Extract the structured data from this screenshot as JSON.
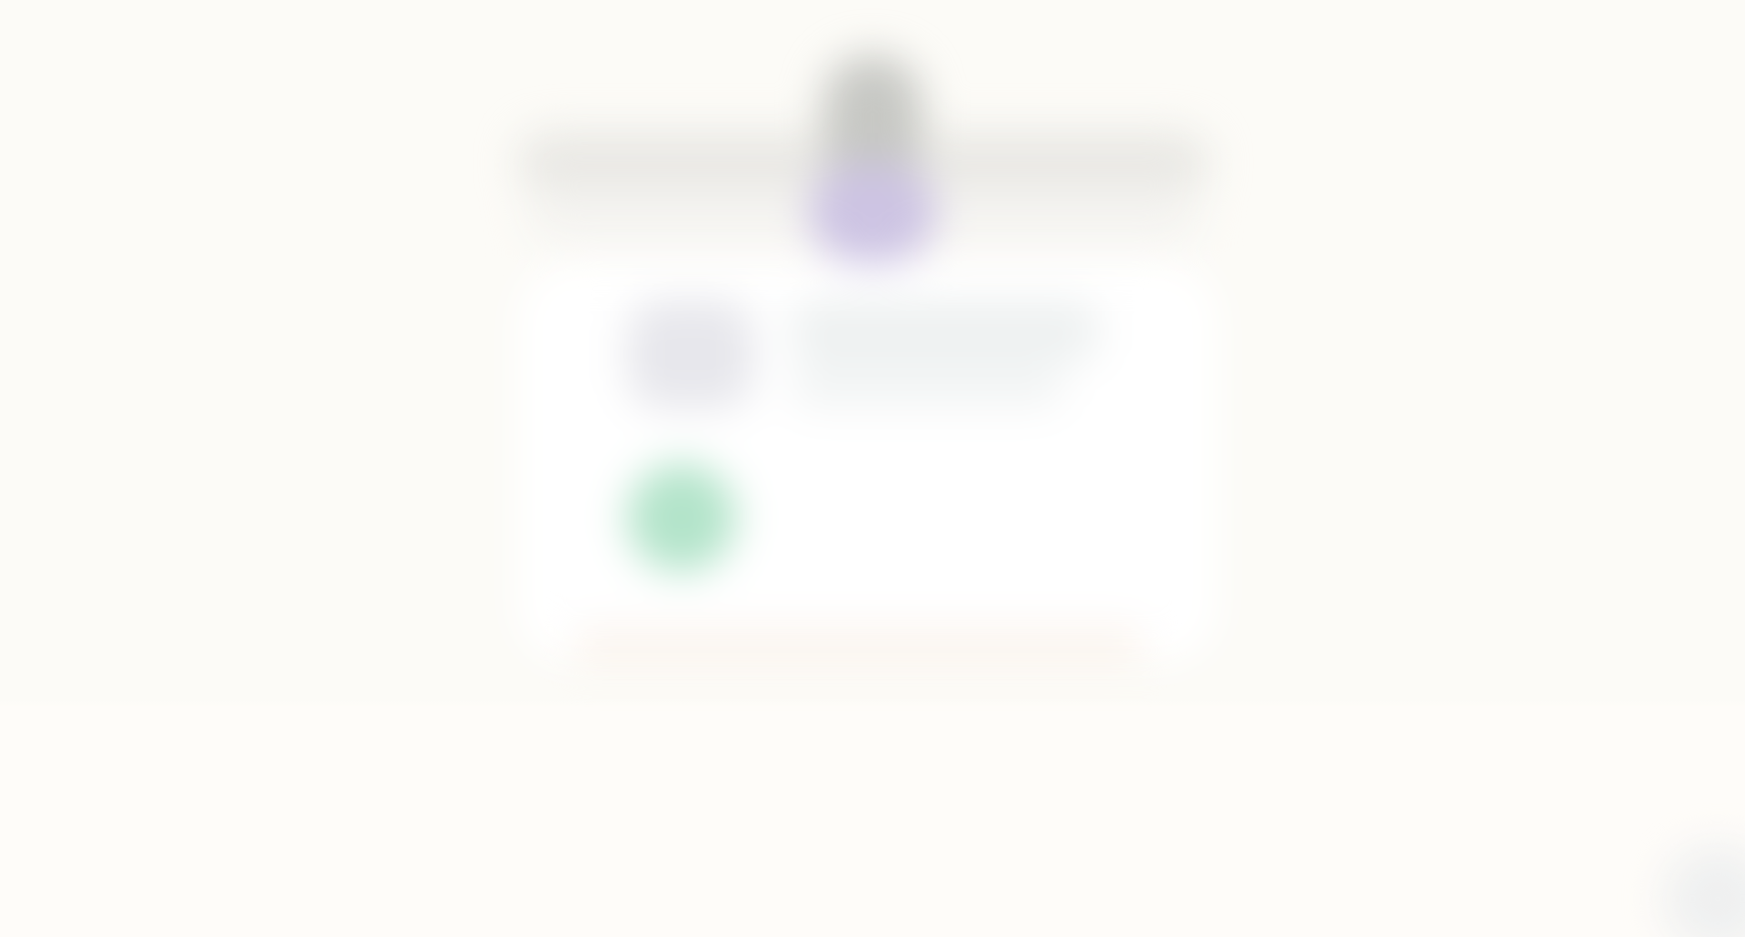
{
  "colors": {
    "background": "#fcfbf7",
    "top_bar": "#e9e8e4",
    "avatar_head": "#c7c8c4",
    "avatar_body": "#cdc4e3",
    "card": "#ffffff",
    "green_icon": "#b3e4ca"
  },
  "icons": {
    "avatar": "user-avatar-icon",
    "status": "green-circle-icon"
  }
}
